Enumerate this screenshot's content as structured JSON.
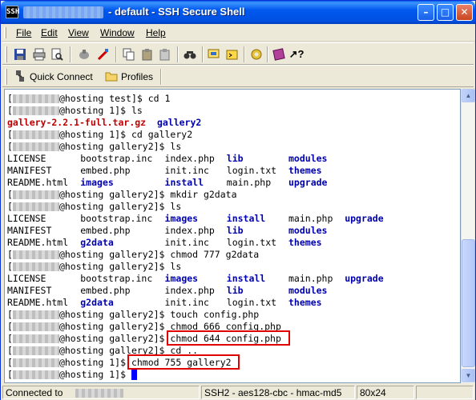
{
  "window": {
    "title": "- default - SSH Secure Shell",
    "icon_label": "SSH",
    "buttons": [
      "minimize",
      "maximize",
      "close"
    ]
  },
  "menu": [
    "File",
    "Edit",
    "View",
    "Window",
    "Help"
  ],
  "toolbar": {
    "icons": [
      "save-icon",
      "print-icon",
      "print-preview-icon",
      "disconnect-icon",
      "edit-icon",
      "copy-icon",
      "paste-icon",
      "paste-doc-icon",
      "find-icon",
      "file-transfer-icon",
      "new-terminal-icon",
      "settings-icon",
      "profile-book-icon",
      "help-icon"
    ],
    "quick_connect": "Quick Connect",
    "profiles": "Profiles"
  },
  "terminal": {
    "lines": [
      {
        "prompt": "@hosting test]$ ",
        "cmd": "cd 1"
      },
      {
        "prompt": "@hosting 1]$ ",
        "cmd": "ls"
      },
      {
        "ls": [
          {
            "t": "gallery-2.2.1-full.tar.gz",
            "c": "red"
          },
          {
            "t": "gallery2",
            "c": "blue"
          }
        ]
      },
      {
        "prompt": "@hosting 1]$ ",
        "cmd": "cd gallery2"
      },
      {
        "prompt": "@hosting gallery2]$ ",
        "cmd": "ls"
      },
      {
        "cols": [
          [
            "LICENSE",
            ""
          ],
          [
            "bootstrap.inc",
            ""
          ],
          [
            "index.php",
            ""
          ],
          [
            "lib",
            "blue"
          ],
          [
            "modules",
            "blue"
          ]
        ]
      },
      {
        "cols": [
          [
            "MANIFEST",
            ""
          ],
          [
            "embed.php",
            ""
          ],
          [
            "init.inc",
            ""
          ],
          [
            "login.txt",
            ""
          ],
          [
            "themes",
            "blue"
          ]
        ]
      },
      {
        "cols": [
          [
            "README.html",
            ""
          ],
          [
            "images",
            "blue"
          ],
          [
            "install",
            "blue"
          ],
          [
            "main.php",
            ""
          ],
          [
            "upgrade",
            "blue"
          ]
        ]
      },
      {
        "prompt": "@hosting gallery2]$ ",
        "cmd": "mkdir g2data"
      },
      {
        "prompt": "@hosting gallery2]$ ",
        "cmd": "ls"
      },
      {
        "cols": [
          [
            "LICENSE",
            ""
          ],
          [
            "bootstrap.inc",
            ""
          ],
          [
            "images",
            "blue"
          ],
          [
            "install",
            "blue"
          ],
          [
            "main.php",
            ""
          ],
          [
            "upgrade",
            "blue"
          ]
        ]
      },
      {
        "cols": [
          [
            "MANIFEST",
            ""
          ],
          [
            "embed.php",
            ""
          ],
          [
            "index.php",
            ""
          ],
          [
            "lib",
            "blue"
          ],
          [
            "modules",
            "blue"
          ]
        ]
      },
      {
        "cols": [
          [
            "README.html",
            ""
          ],
          [
            "g2data",
            "blue"
          ],
          [
            "init.inc",
            ""
          ],
          [
            "login.txt",
            ""
          ],
          [
            "themes",
            "blue"
          ]
        ]
      },
      {
        "prompt": "@hosting gallery2]$ ",
        "cmd": "chmod 777 g2data"
      },
      {
        "prompt": "@hosting gallery2]$ ",
        "cmd": "ls"
      },
      {
        "cols": [
          [
            "LICENSE",
            ""
          ],
          [
            "bootstrap.inc",
            ""
          ],
          [
            "images",
            "blue"
          ],
          [
            "install",
            "blue"
          ],
          [
            "main.php",
            ""
          ],
          [
            "upgrade",
            "blue"
          ]
        ]
      },
      {
        "cols": [
          [
            "MANIFEST",
            ""
          ],
          [
            "embed.php",
            ""
          ],
          [
            "index.php",
            ""
          ],
          [
            "lib",
            "blue"
          ],
          [
            "modules",
            "blue"
          ]
        ]
      },
      {
        "cols": [
          [
            "README.html",
            ""
          ],
          [
            "g2data",
            "blue"
          ],
          [
            "init.inc",
            ""
          ],
          [
            "login.txt",
            ""
          ],
          [
            "themes",
            "blue"
          ]
        ]
      },
      {
        "prompt": "@hosting gallery2]$ ",
        "cmd": "touch config.php"
      },
      {
        "prompt": "@hosting gallery2]$ ",
        "cmd": "chmod 666 config.php"
      },
      {
        "prompt": "@hosting gallery2]$ ",
        "cmd": "chmod 644 config.php",
        "hl": true
      },
      {
        "prompt": "@hosting gallery2]$ ",
        "cmd": "cd .."
      },
      {
        "prompt": "@hosting 1]$ ",
        "cmd": "chmod 755 gallery2",
        "hl": true
      },
      {
        "prompt": "@hosting 1]$ ",
        "cmd": "",
        "cursor": true
      }
    ]
  },
  "status": {
    "connected": "Connected to",
    "encryption": "SSH2 - aes128-cbc - hmac-md5",
    "size": "80x24"
  }
}
